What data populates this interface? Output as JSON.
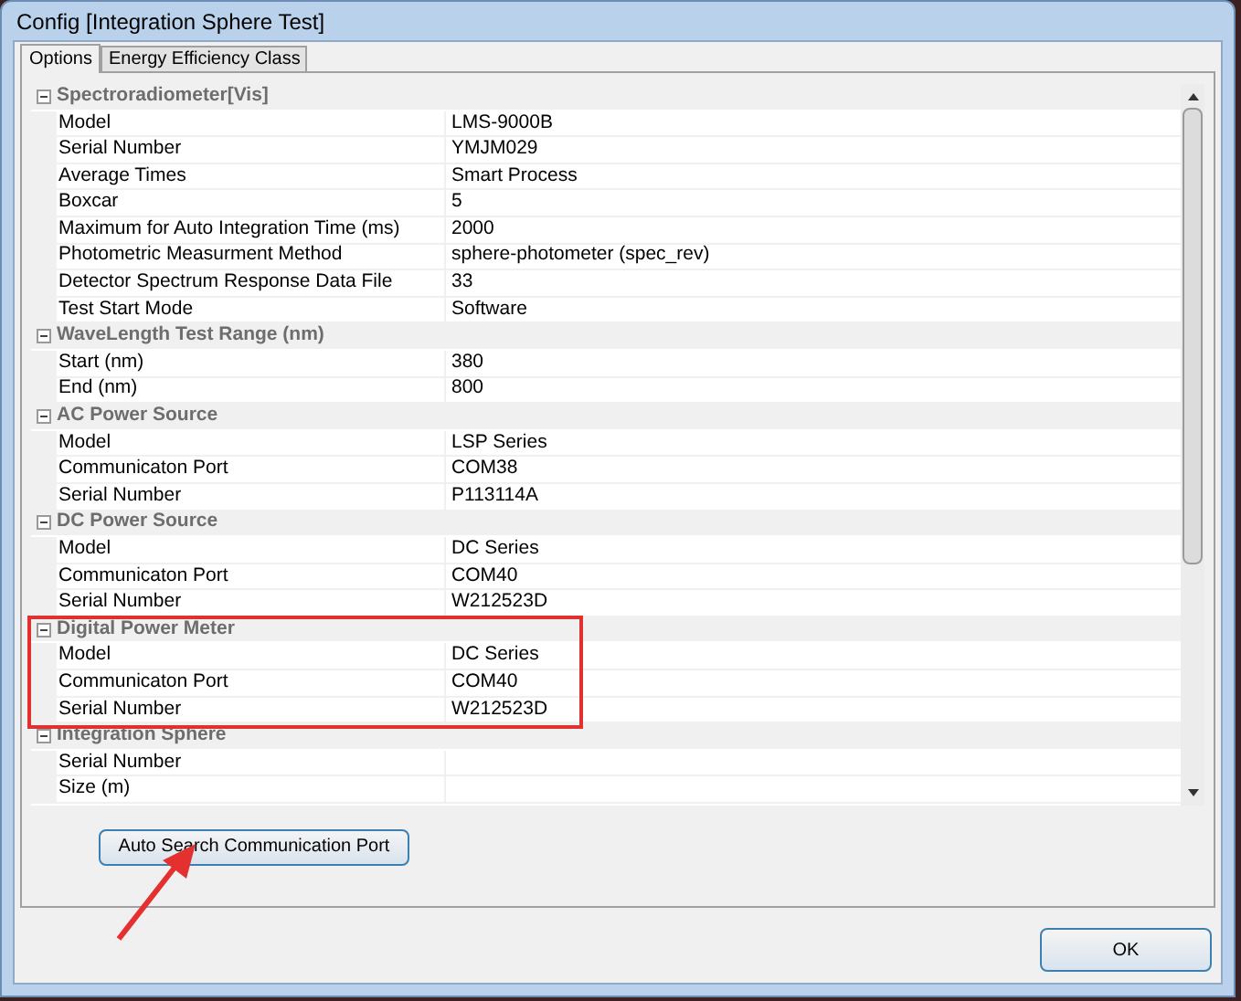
{
  "window": {
    "title": "Config [Integration Sphere Test]"
  },
  "tabs": [
    {
      "label": "Options",
      "selected": true
    },
    {
      "label": "Energy Efficiency Class",
      "selected": false
    }
  ],
  "groups": [
    {
      "title": "Spectroradiometer[Vis]",
      "expanded": true,
      "highlighted": false,
      "properties": [
        {
          "name": "Model",
          "value": "LMS-9000B"
        },
        {
          "name": "Serial Number",
          "value": "YMJM029"
        },
        {
          "name": "Average Times",
          "value": "Smart Process"
        },
        {
          "name": "Boxcar",
          "value": "5"
        },
        {
          "name": "Maximum for Auto Integration Time (ms)",
          "value": "2000"
        },
        {
          "name": "Photometric Measurment Method",
          "value": "sphere-photometer (spec_rev)"
        },
        {
          "name": "Detector Spectrum Response Data File",
          "value": "33"
        },
        {
          "name": "Test Start Mode",
          "value": "Software"
        }
      ]
    },
    {
      "title": "WaveLength Test Range (nm)",
      "expanded": true,
      "highlighted": false,
      "properties": [
        {
          "name": "Start (nm)",
          "value": "380"
        },
        {
          "name": "End (nm)",
          "value": "800"
        }
      ]
    },
    {
      "title": "AC Power Source",
      "expanded": true,
      "highlighted": false,
      "properties": [
        {
          "name": "Model",
          "value": "LSP Series"
        },
        {
          "name": "Communicaton Port",
          "value": "COM38"
        },
        {
          "name": "Serial Number",
          "value": "P113114A"
        }
      ]
    },
    {
      "title": "DC Power Source",
      "expanded": true,
      "highlighted": false,
      "properties": [
        {
          "name": "Model",
          "value": "DC Series"
        },
        {
          "name": "Communicaton Port",
          "value": "COM40"
        },
        {
          "name": "Serial Number",
          "value": "W212523D"
        }
      ]
    },
    {
      "title": "Digital Power Meter",
      "expanded": true,
      "highlighted": true,
      "properties": [
        {
          "name": "Model",
          "value": "DC Series"
        },
        {
          "name": "Communicaton Port",
          "value": "COM40"
        },
        {
          "name": "Serial Number",
          "value": "W212523D"
        }
      ]
    },
    {
      "title": "Integration Sphere",
      "expanded": true,
      "highlighted": false,
      "properties": [
        {
          "name": "Serial Number"
        },
        {
          "name": "Size (m)"
        }
      ]
    }
  ],
  "search_button": {
    "label": "Auto Search Communication Port",
    "arrow_annotation": true
  },
  "ok_button": {
    "label": "OK"
  }
}
